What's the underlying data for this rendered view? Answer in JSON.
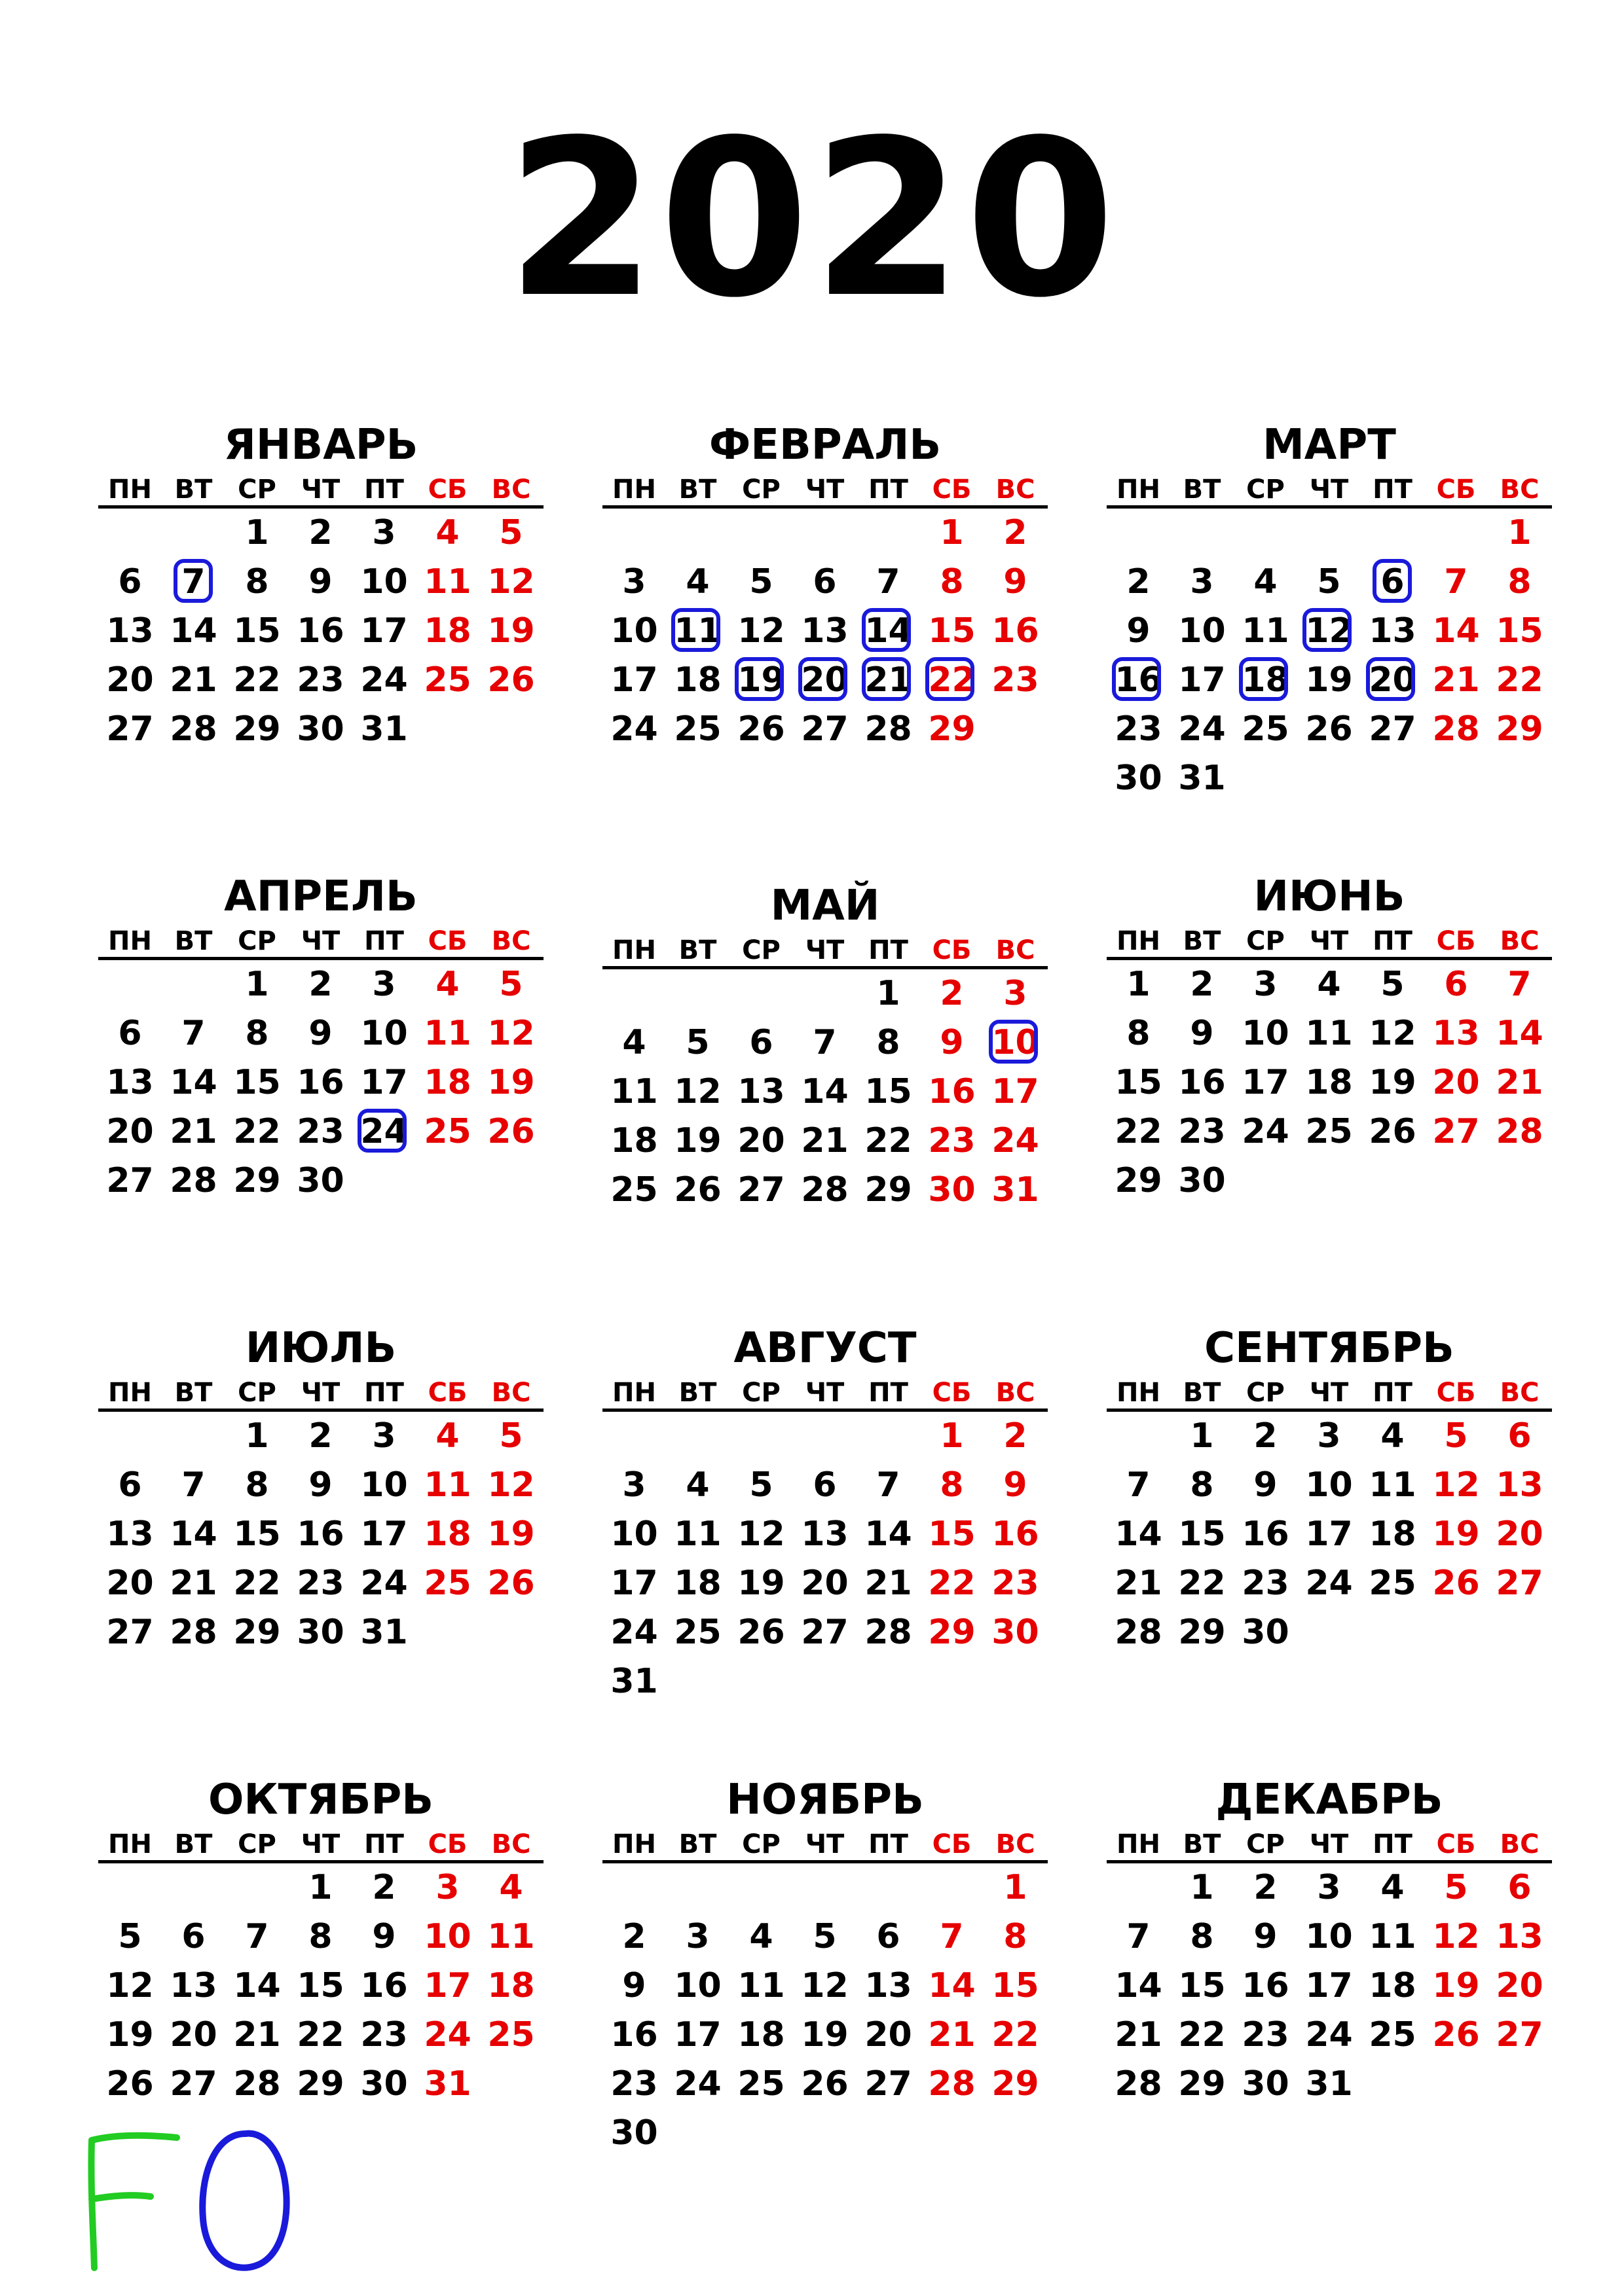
{
  "year": "2020",
  "weekdays": [
    "ПН",
    "ВТ",
    "СР",
    "ЧТ",
    "ПТ",
    "СБ",
    "ВС"
  ],
  "colors": {
    "weekend": "#e60000",
    "text": "#000000",
    "mark": "#1a1adb",
    "scribble_f": "#22cc22",
    "scribble_o": "#1a1adb"
  },
  "months": [
    {
      "name": "ЯНВАРЬ",
      "offset": 2,
      "days": 31,
      "marked": [
        7
      ]
    },
    {
      "name": "ФЕВРАЛЬ",
      "offset": 5,
      "days": 29,
      "marked": [
        11,
        14,
        19,
        20,
        21,
        22
      ]
    },
    {
      "name": "МАРТ",
      "offset": 6,
      "days": 31,
      "marked": [
        6,
        12,
        16,
        18,
        20
      ]
    },
    {
      "name": "АПРЕЛЬ",
      "offset": 2,
      "days": 30,
      "marked": [
        24
      ]
    },
    {
      "name": "МАЙ",
      "offset": 4,
      "days": 31,
      "marked": [
        10
      ]
    },
    {
      "name": "ИЮНЬ",
      "offset": 0,
      "days": 30,
      "marked": []
    },
    {
      "name": "ИЮЛЬ",
      "offset": 2,
      "days": 31,
      "marked": []
    },
    {
      "name": "АВГУСТ",
      "offset": 5,
      "days": 31,
      "marked": []
    },
    {
      "name": "СЕНТЯБРЬ",
      "offset": 1,
      "days": 30,
      "marked": []
    },
    {
      "name": "ОКТЯБРЬ",
      "offset": 3,
      "days": 31,
      "marked": []
    },
    {
      "name": "НОЯБРЬ",
      "offset": 6,
      "days": 30,
      "marked": []
    },
    {
      "name": "ДЕКАБРЬ",
      "offset": 1,
      "days": 31,
      "marked": []
    }
  ],
  "handwriting": {
    "letters": [
      "F",
      "O"
    ]
  }
}
